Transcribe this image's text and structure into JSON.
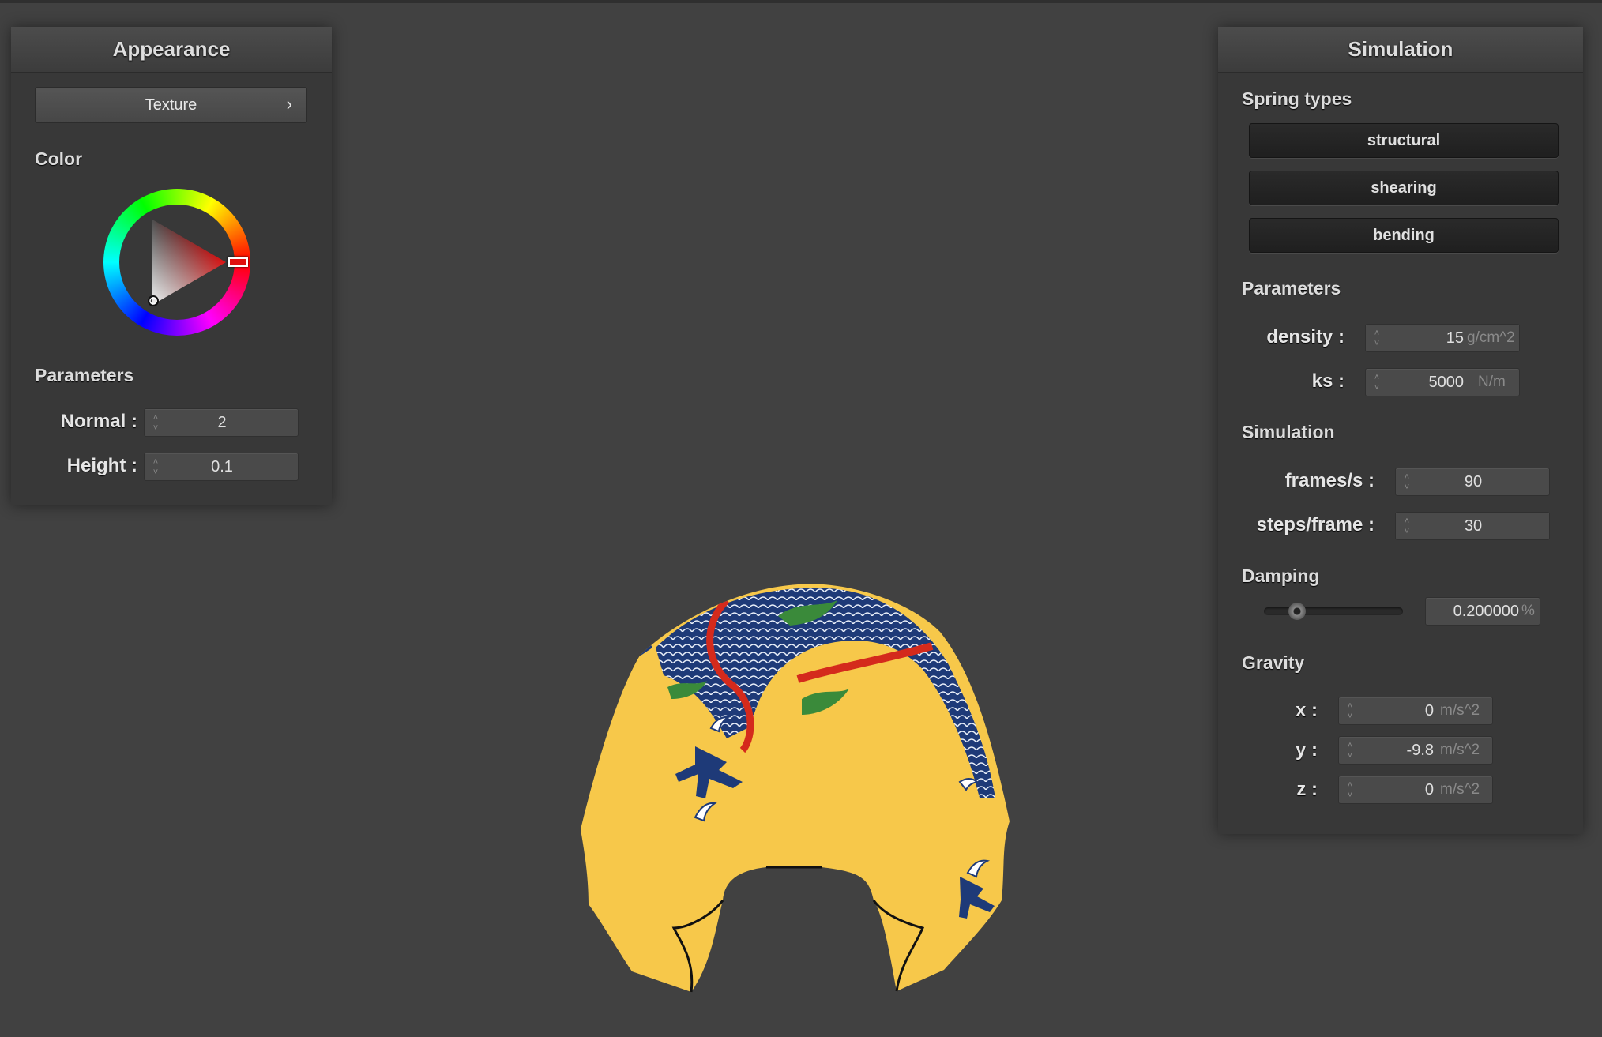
{
  "appearance": {
    "title": "Appearance",
    "texture_button": "Texture",
    "texture_chevron": "›",
    "color_label": "Color",
    "selected_color": "#e01010",
    "parameters_label": "Parameters",
    "normal_label": "Normal :",
    "normal_value": "2",
    "height_label": "Height :",
    "height_value": "0.1"
  },
  "simulation": {
    "title": "Simulation",
    "spring_types_label": "Spring types",
    "spring_types": [
      "structural",
      "shearing",
      "bending"
    ],
    "parameters_label": "Parameters",
    "density_label": "density :",
    "density_value": "15",
    "density_unit": "g/cm^2",
    "ks_label": "ks :",
    "ks_value": "5000",
    "ks_unit": "N/m",
    "simulation_label": "Simulation",
    "fps_label": "frames/s :",
    "fps_value": "90",
    "steps_label": "steps/frame :",
    "steps_value": "30",
    "damping_label": "Damping",
    "damping_value": "0.200000",
    "damping_unit": "%",
    "damping_fraction": 0.2,
    "gravity_label": "Gravity",
    "gx_label": "x :",
    "gx_value": "0",
    "gy_label": "y :",
    "gy_value": "-9.8",
    "gz_label": "z :",
    "gz_value": "0",
    "gravity_unit": "m/s^2"
  },
  "colors": {
    "background": "#414141",
    "cloth": "#f7c84a",
    "dragon_blue": "#1e3a78",
    "dragon_red": "#d42a1c",
    "dragon_green": "#3a8a3a"
  }
}
